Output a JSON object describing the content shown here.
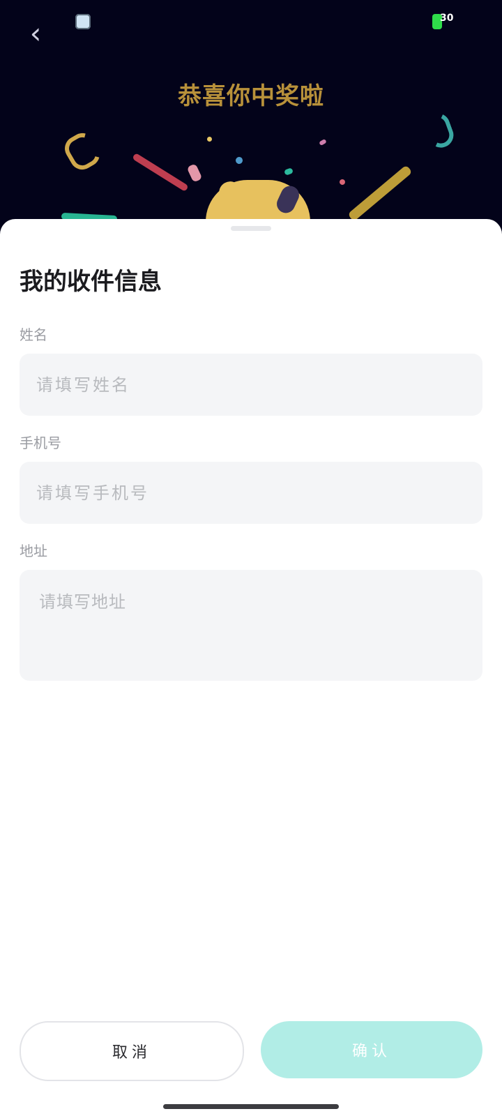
{
  "status_bar": {
    "battery_level": "30",
    "battery_color": "#2fdd4a"
  },
  "header": {
    "congrats_text": "恭喜你中奖啦"
  },
  "sheet": {
    "title": "我的收件信息",
    "fields": [
      {
        "label": "姓名",
        "placeholder": "请填写姓名",
        "value": ""
      },
      {
        "label": "手机号",
        "placeholder": "请填写手机号",
        "value": ""
      },
      {
        "label": "地址",
        "placeholder": "请填写地址",
        "value": ""
      }
    ],
    "buttons": {
      "cancel": "取消",
      "confirm": "确认"
    }
  },
  "colors": {
    "background_top": "#03031a",
    "accent_confirm": "#b1ede6",
    "title_gold": "#b8913a"
  }
}
